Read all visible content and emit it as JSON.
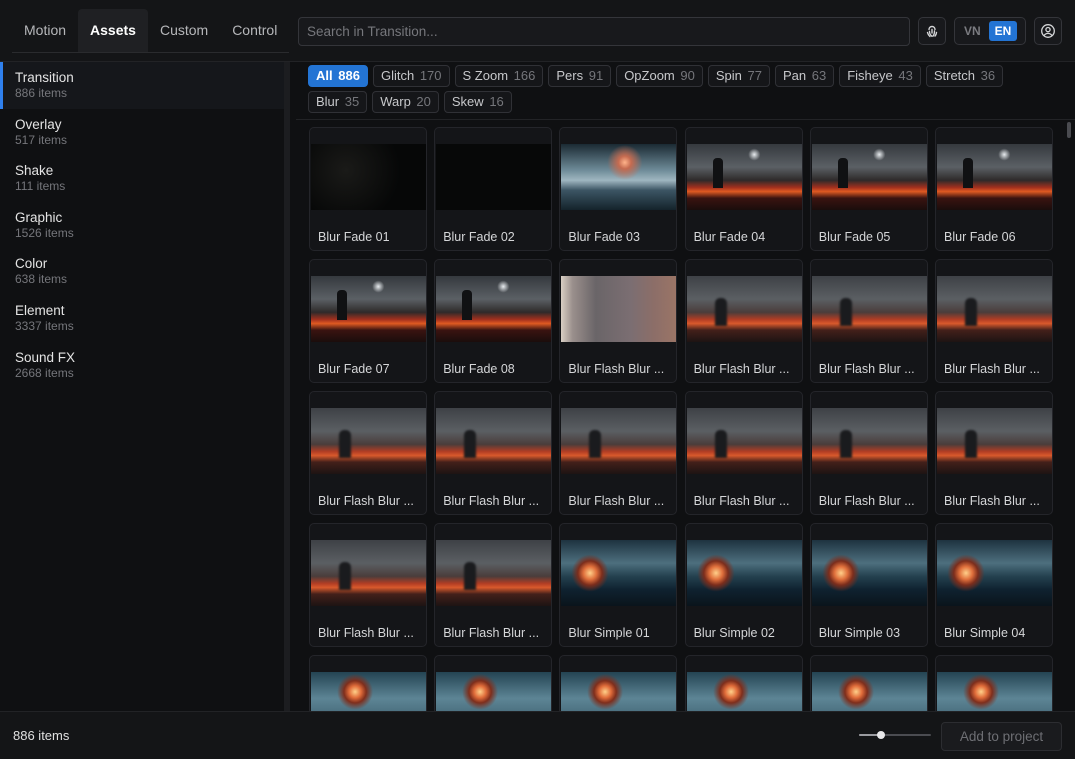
{
  "tabs": [
    {
      "label": "Motion",
      "active": false
    },
    {
      "label": "Assets",
      "active": true
    },
    {
      "label": "Custom",
      "active": false
    },
    {
      "label": "Control",
      "active": false
    }
  ],
  "search": {
    "placeholder": "Search in Transition...",
    "value": ""
  },
  "icons": {
    "filter": "fingerprint-icon",
    "account": "user-circle-icon"
  },
  "language": {
    "options": [
      "VN",
      "EN"
    ],
    "selected": "EN"
  },
  "accent_color": "#2374d4",
  "categories": [
    {
      "name": "Transition",
      "count": "886 items",
      "active": true
    },
    {
      "name": "Overlay",
      "count": "517 items",
      "active": false
    },
    {
      "name": "Shake",
      "count": "111 items",
      "active": false
    },
    {
      "name": "Graphic",
      "count": "1526 items",
      "active": false
    },
    {
      "name": "Color",
      "count": "638 items",
      "active": false
    },
    {
      "name": "Element",
      "count": "3337 items",
      "active": false
    },
    {
      "name": "Sound FX",
      "count": "2668 items",
      "active": false
    }
  ],
  "filters": [
    {
      "label": "All",
      "count": "886",
      "active": true
    },
    {
      "label": "Glitch",
      "count": "170",
      "active": false
    },
    {
      "label": "S Zoom",
      "count": "166",
      "active": false
    },
    {
      "label": "Pers",
      "count": "91",
      "active": false
    },
    {
      "label": "OpZoom",
      "count": "90",
      "active": false
    },
    {
      "label": "Spin",
      "count": "77",
      "active": false
    },
    {
      "label": "Pan",
      "count": "63",
      "active": false
    },
    {
      "label": "Fisheye",
      "count": "43",
      "active": false
    },
    {
      "label": "Stretch",
      "count": "36",
      "active": false
    },
    {
      "label": "Blur",
      "count": "35",
      "active": false
    },
    {
      "label": "Warp",
      "count": "20",
      "active": false
    },
    {
      "label": "Skew",
      "count": "16",
      "active": false
    }
  ],
  "assets": [
    {
      "label": "Blur Fade 01",
      "thumb": "dark"
    },
    {
      "label": "Blur Fade 02",
      "thumb": "darker"
    },
    {
      "label": "Blur Fade 03",
      "thumb": "storm"
    },
    {
      "label": "Blur Fade 04",
      "thumb": "lava"
    },
    {
      "label": "Blur Fade 05",
      "thumb": "lava"
    },
    {
      "label": "Blur Fade 06",
      "thumb": "lava"
    },
    {
      "label": "Blur Fade 07",
      "thumb": "lava"
    },
    {
      "label": "Blur Fade 08",
      "thumb": "lava"
    },
    {
      "label": "Blur Flash Blur ...",
      "thumb": "flashlight"
    },
    {
      "label": "Blur Flash Blur ...",
      "thumb": "blur"
    },
    {
      "label": "Blur Flash Blur ...",
      "thumb": "blur"
    },
    {
      "label": "Blur Flash Blur ...",
      "thumb": "blur"
    },
    {
      "label": "Blur Flash Blur ...",
      "thumb": "blur"
    },
    {
      "label": "Blur Flash Blur ...",
      "thumb": "blur"
    },
    {
      "label": "Blur Flash Blur ...",
      "thumb": "blur"
    },
    {
      "label": "Blur Flash Blur ...",
      "thumb": "blur"
    },
    {
      "label": "Blur Flash Blur ...",
      "thumb": "blur"
    },
    {
      "label": "Blur Flash Blur ...",
      "thumb": "blur"
    },
    {
      "label": "Blur Flash Blur ...",
      "thumb": "blur"
    },
    {
      "label": "Blur Flash Blur ...",
      "thumb": "blur"
    },
    {
      "label": "Blur Simple 01",
      "thumb": "ocean"
    },
    {
      "label": "Blur Simple 02",
      "thumb": "ocean"
    },
    {
      "label": "Blur Simple 03",
      "thumb": "ocean"
    },
    {
      "label": "Blur Simple 04",
      "thumb": "ocean"
    },
    {
      "label": "",
      "thumb": "ocean2"
    },
    {
      "label": "",
      "thumb": "ocean2"
    },
    {
      "label": "",
      "thumb": "ocean2"
    },
    {
      "label": "",
      "thumb": "ocean2"
    },
    {
      "label": "",
      "thumb": "ocean2"
    },
    {
      "label": "",
      "thumb": "ocean2"
    }
  ],
  "footer": {
    "count_label": "886 items",
    "zoom_level": 0.3,
    "add_label": "Add to project"
  }
}
